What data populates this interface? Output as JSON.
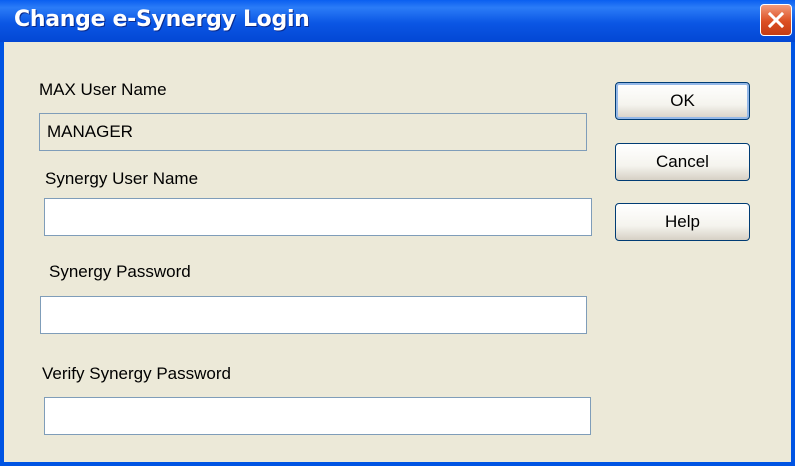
{
  "window": {
    "title": "Change e-Synergy Login",
    "close_icon": "close-icon"
  },
  "form": {
    "max_user_label": "MAX User Name",
    "max_user_value": "MANAGER",
    "synergy_user_label": "Synergy User Name",
    "synergy_user_value": "",
    "synergy_password_label": "Synergy Password",
    "synergy_password_value": "",
    "verify_password_label": "Verify Synergy Password",
    "verify_password_value": ""
  },
  "buttons": {
    "ok": "OK",
    "cancel": "Cancel",
    "help": "Help"
  },
  "colors": {
    "titlebar": "#0054e3",
    "dialog_bg": "#ece9d8",
    "close_button": "#dc4f22"
  }
}
